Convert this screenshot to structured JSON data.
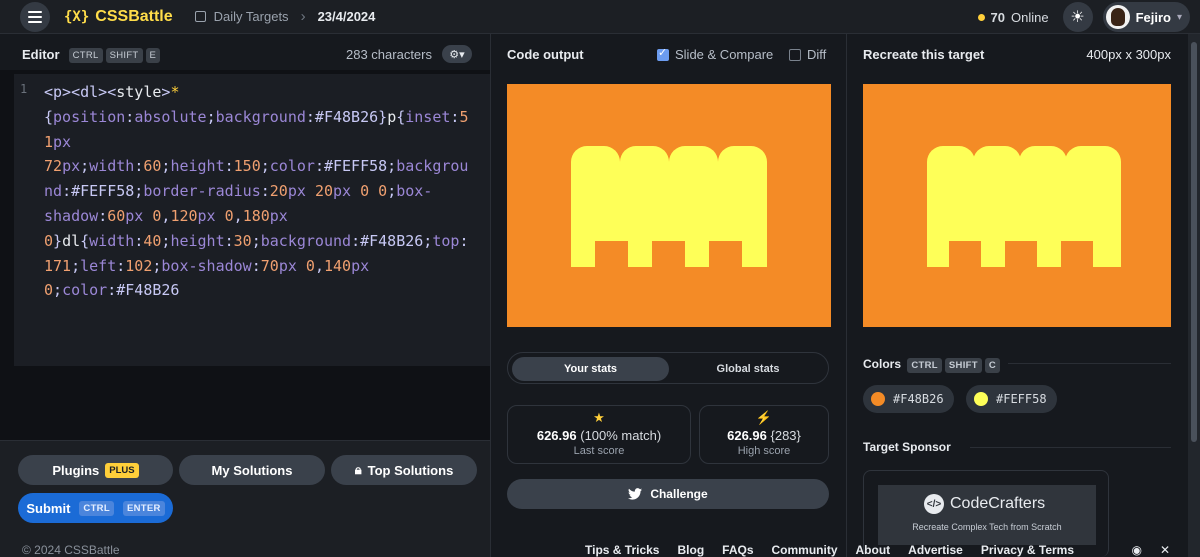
{
  "header": {
    "logo_text": "CSSBattle",
    "logo_mark": "{X}",
    "breadcrumb_section": "Daily Targets",
    "breadcrumb_date": "23/4/2024",
    "online_count": "70",
    "online_label": "Online",
    "username": "Fejiro"
  },
  "editor": {
    "title": "Editor",
    "shortcut": [
      "CTRL",
      "SHIFT",
      "E"
    ],
    "char_count": "283 characters",
    "line_number": "1"
  },
  "output": {
    "title": "Code output",
    "slide_compare_label": "Slide & Compare",
    "slide_compare_checked": true,
    "diff_label": "Diff",
    "diff_checked": false
  },
  "target": {
    "title": "Recreate this target",
    "dimensions": "400px x 300px",
    "colors_title": "Colors",
    "colors_shortcut": [
      "CTRL",
      "SHIFT",
      "C"
    ],
    "colors": [
      {
        "hex": "#F48B26",
        "label": "#F48B26"
      },
      {
        "hex": "#FEFF58",
        "label": "#FEFF58"
      }
    ],
    "sponsor_title": "Target Sponsor",
    "sponsor_name": "CodeCrafters",
    "sponsor_tagline": "Recreate Complex Tech from Scratch"
  },
  "stats": {
    "tab_your": "Your stats",
    "tab_global": "Global stats",
    "last_score": "626.96",
    "last_match": "(100% match)",
    "last_label": "Last score",
    "high_score": "626.96",
    "high_chars": "{283}",
    "high_label": "High score",
    "challenge_label": "Challenge"
  },
  "buttons": {
    "plugins": "Plugins",
    "plus_badge": "PLUS",
    "my_solutions": "My Solutions",
    "top_solutions": "Top Solutions",
    "submit": "Submit",
    "submit_shortcut": [
      "CTRL",
      "ENTER"
    ]
  },
  "footer": {
    "copyright": "© 2024 CSSBattle",
    "links": [
      "Tips & Tricks",
      "Blog",
      "FAQs",
      "Community",
      "About",
      "Advertise",
      "Privacy & Terms"
    ]
  },
  "accent_colors": {
    "orange": "#F48B26",
    "yellow": "#FEFF58",
    "submit_blue": "#1b6bd6",
    "logo_yellow": "#ffdd4a"
  }
}
